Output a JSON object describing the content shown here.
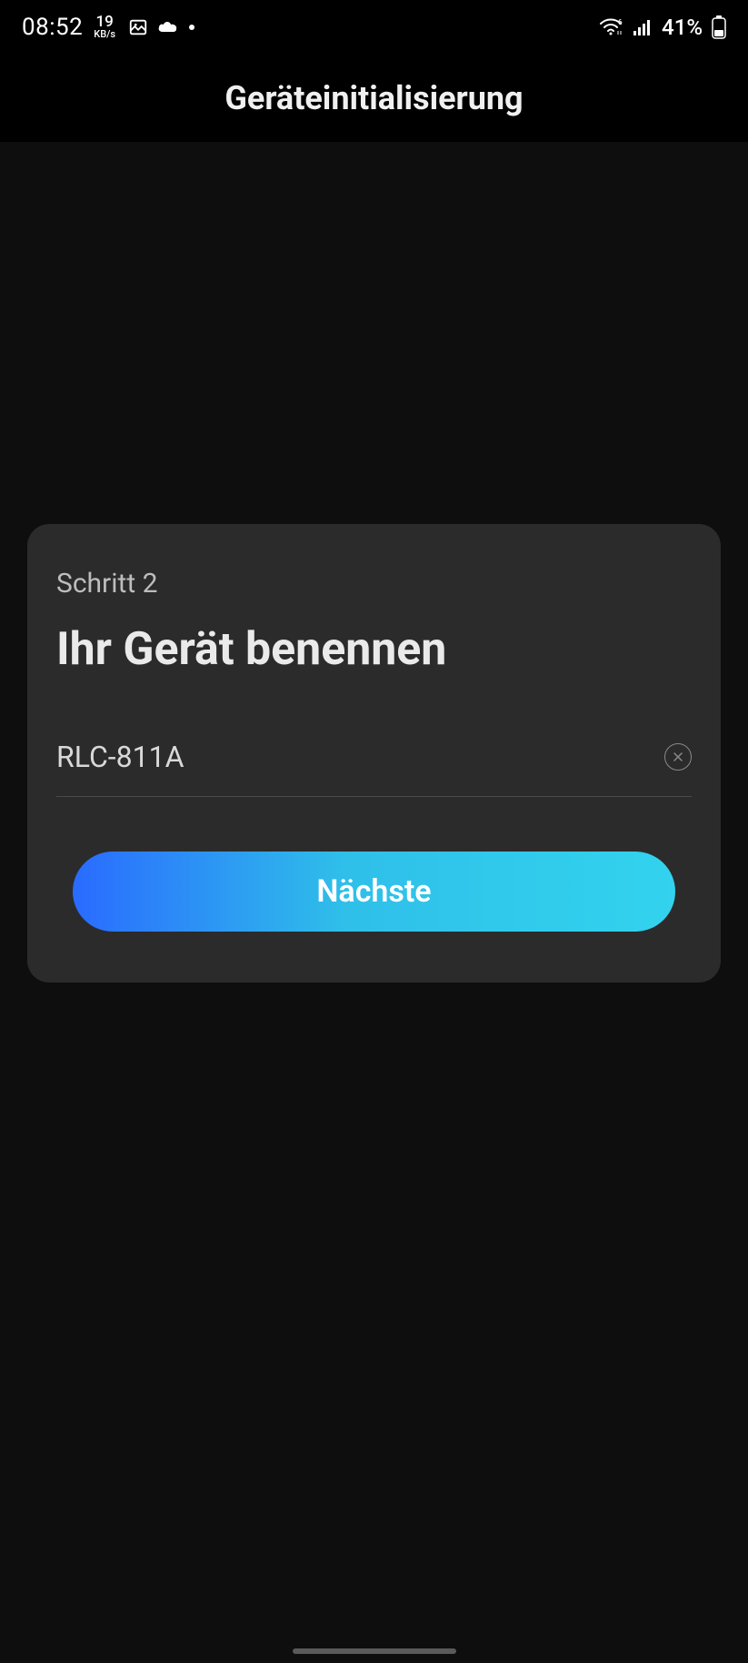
{
  "status": {
    "time": "08:52",
    "net_speed_value": "19",
    "net_speed_unit": "KB/s",
    "battery_text": "41%"
  },
  "header": {
    "title": "Geräteinitialisierung"
  },
  "card": {
    "step_label": "Schritt 2",
    "title": "Ihr Gerät benennen",
    "device_name_value": "RLC-811A",
    "next_button_label": "Nächste"
  }
}
